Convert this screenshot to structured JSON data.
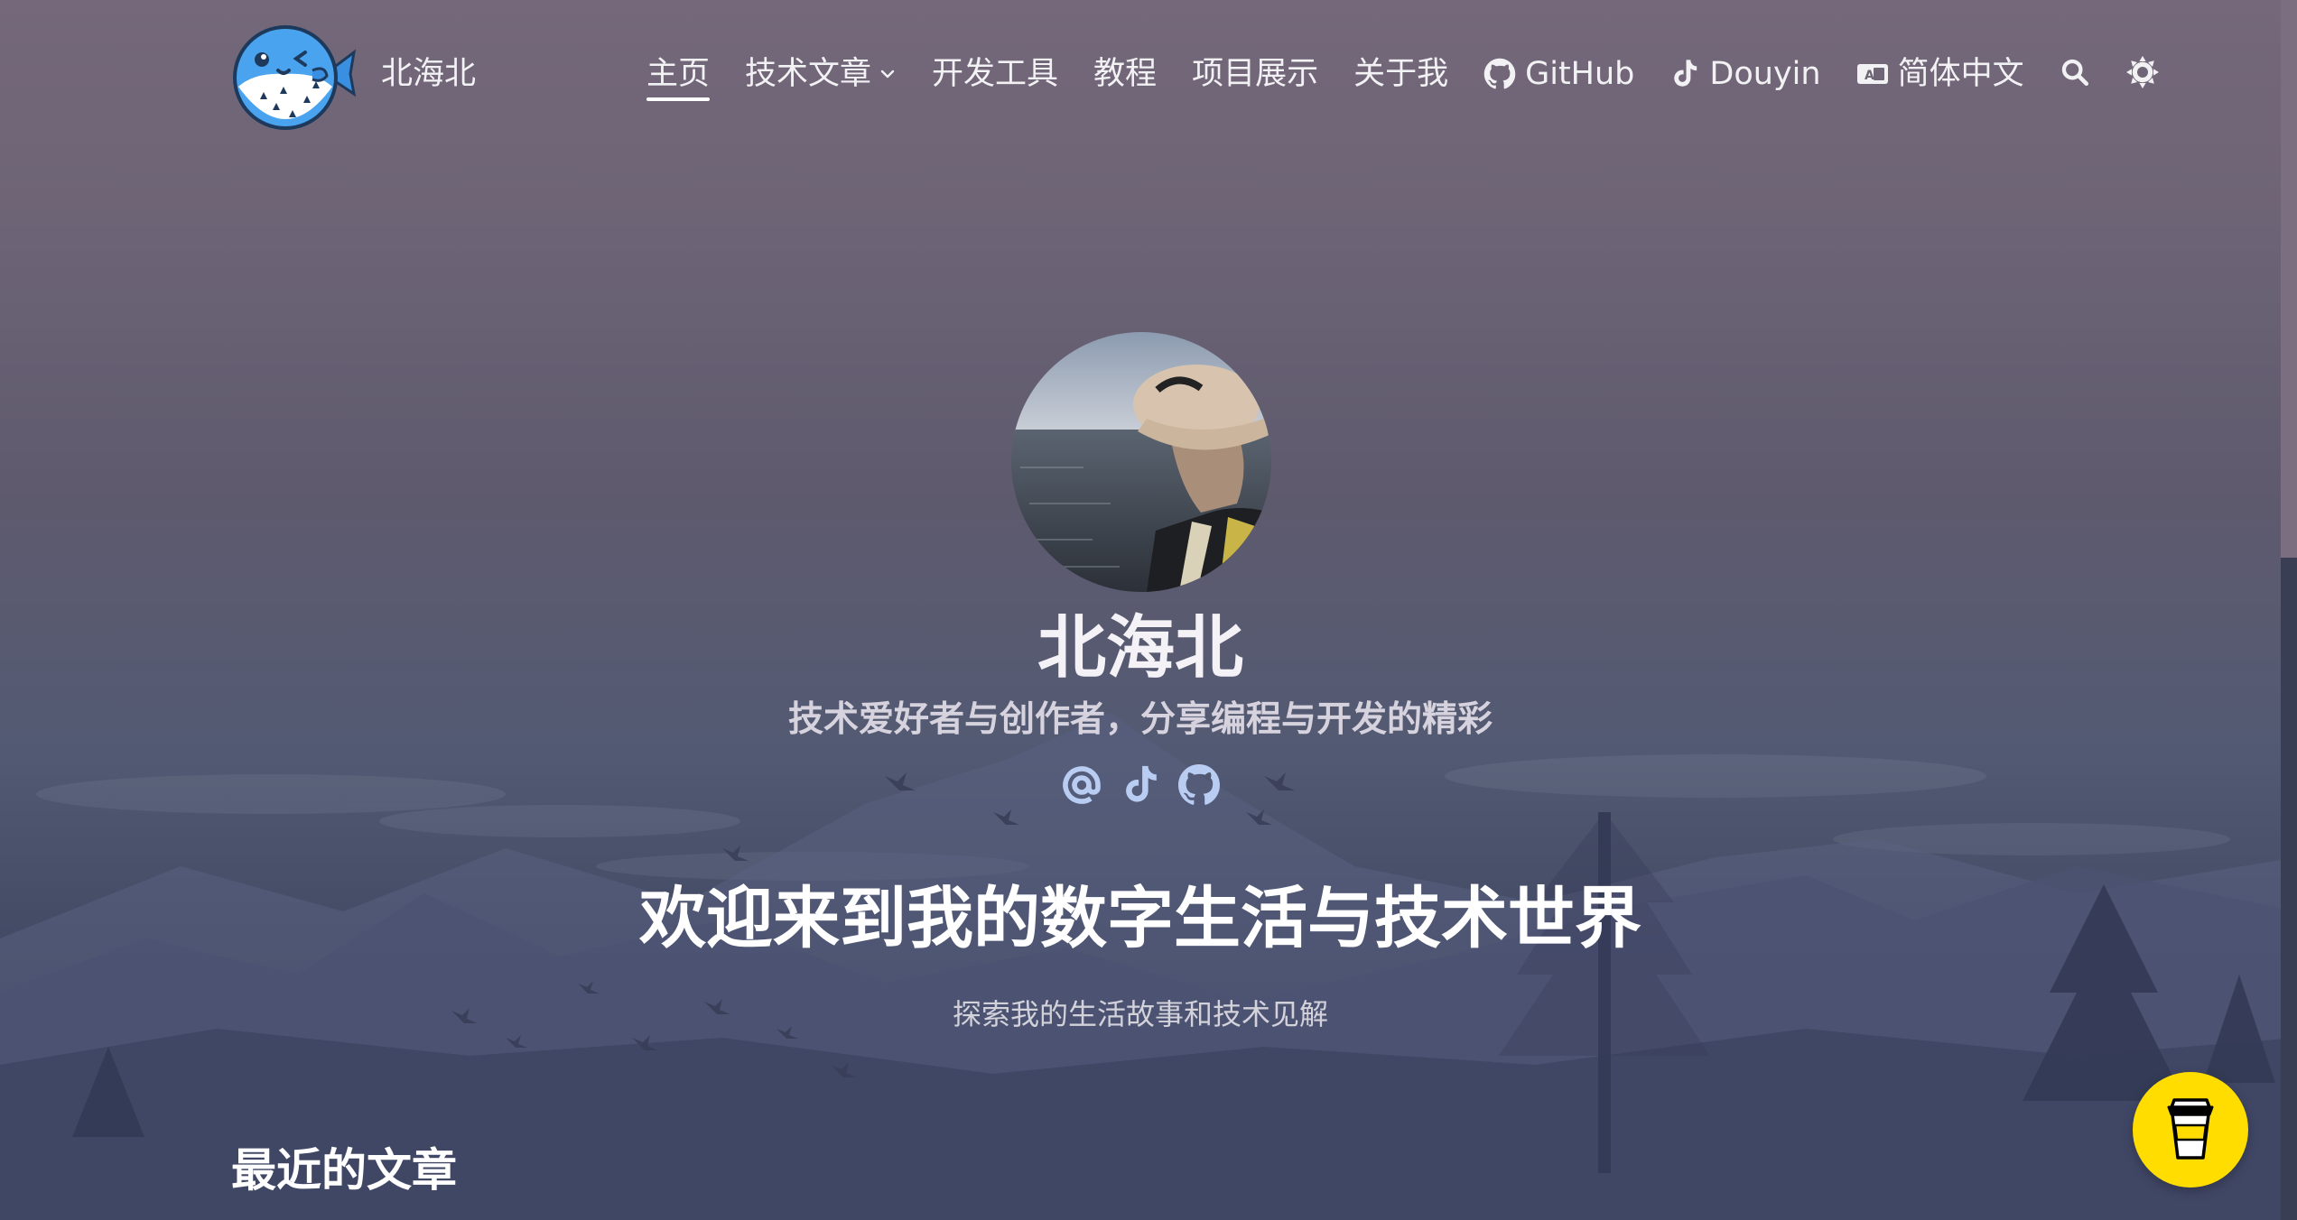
{
  "header": {
    "site_title": "北海北",
    "logo_icon": "pufferfish-logo-icon",
    "nav": [
      {
        "label": "主页",
        "active": true
      },
      {
        "label": "技术文章",
        "has_dropdown": true
      },
      {
        "label": "开发工具"
      },
      {
        "label": "教程"
      },
      {
        "label": "项目展示"
      },
      {
        "label": "关于我"
      },
      {
        "label": "GitHub",
        "icon": "github-icon"
      },
      {
        "label": "Douyin",
        "icon": "tiktok-icon"
      },
      {
        "label": "简体中文",
        "icon": "language-icon"
      }
    ],
    "search_icon": "search-icon",
    "theme_icon": "sun-icon"
  },
  "hero": {
    "name": "北海北",
    "tagline": "技术爱好者与创作者，分享编程与开发的精彩",
    "social_icons": [
      "at-email-icon",
      "tiktok-icon",
      "github-icon"
    ],
    "social_color": "#b9cdf3",
    "welcome": "欢迎来到我的数字生活与技术世界",
    "subtitle": "探索我的生活故事和技术见解"
  },
  "main": {
    "section_title": "最近的文章"
  },
  "floating": {
    "coffee_icon": "coffee-cup-icon",
    "coffee_color": "#ffdd00"
  }
}
